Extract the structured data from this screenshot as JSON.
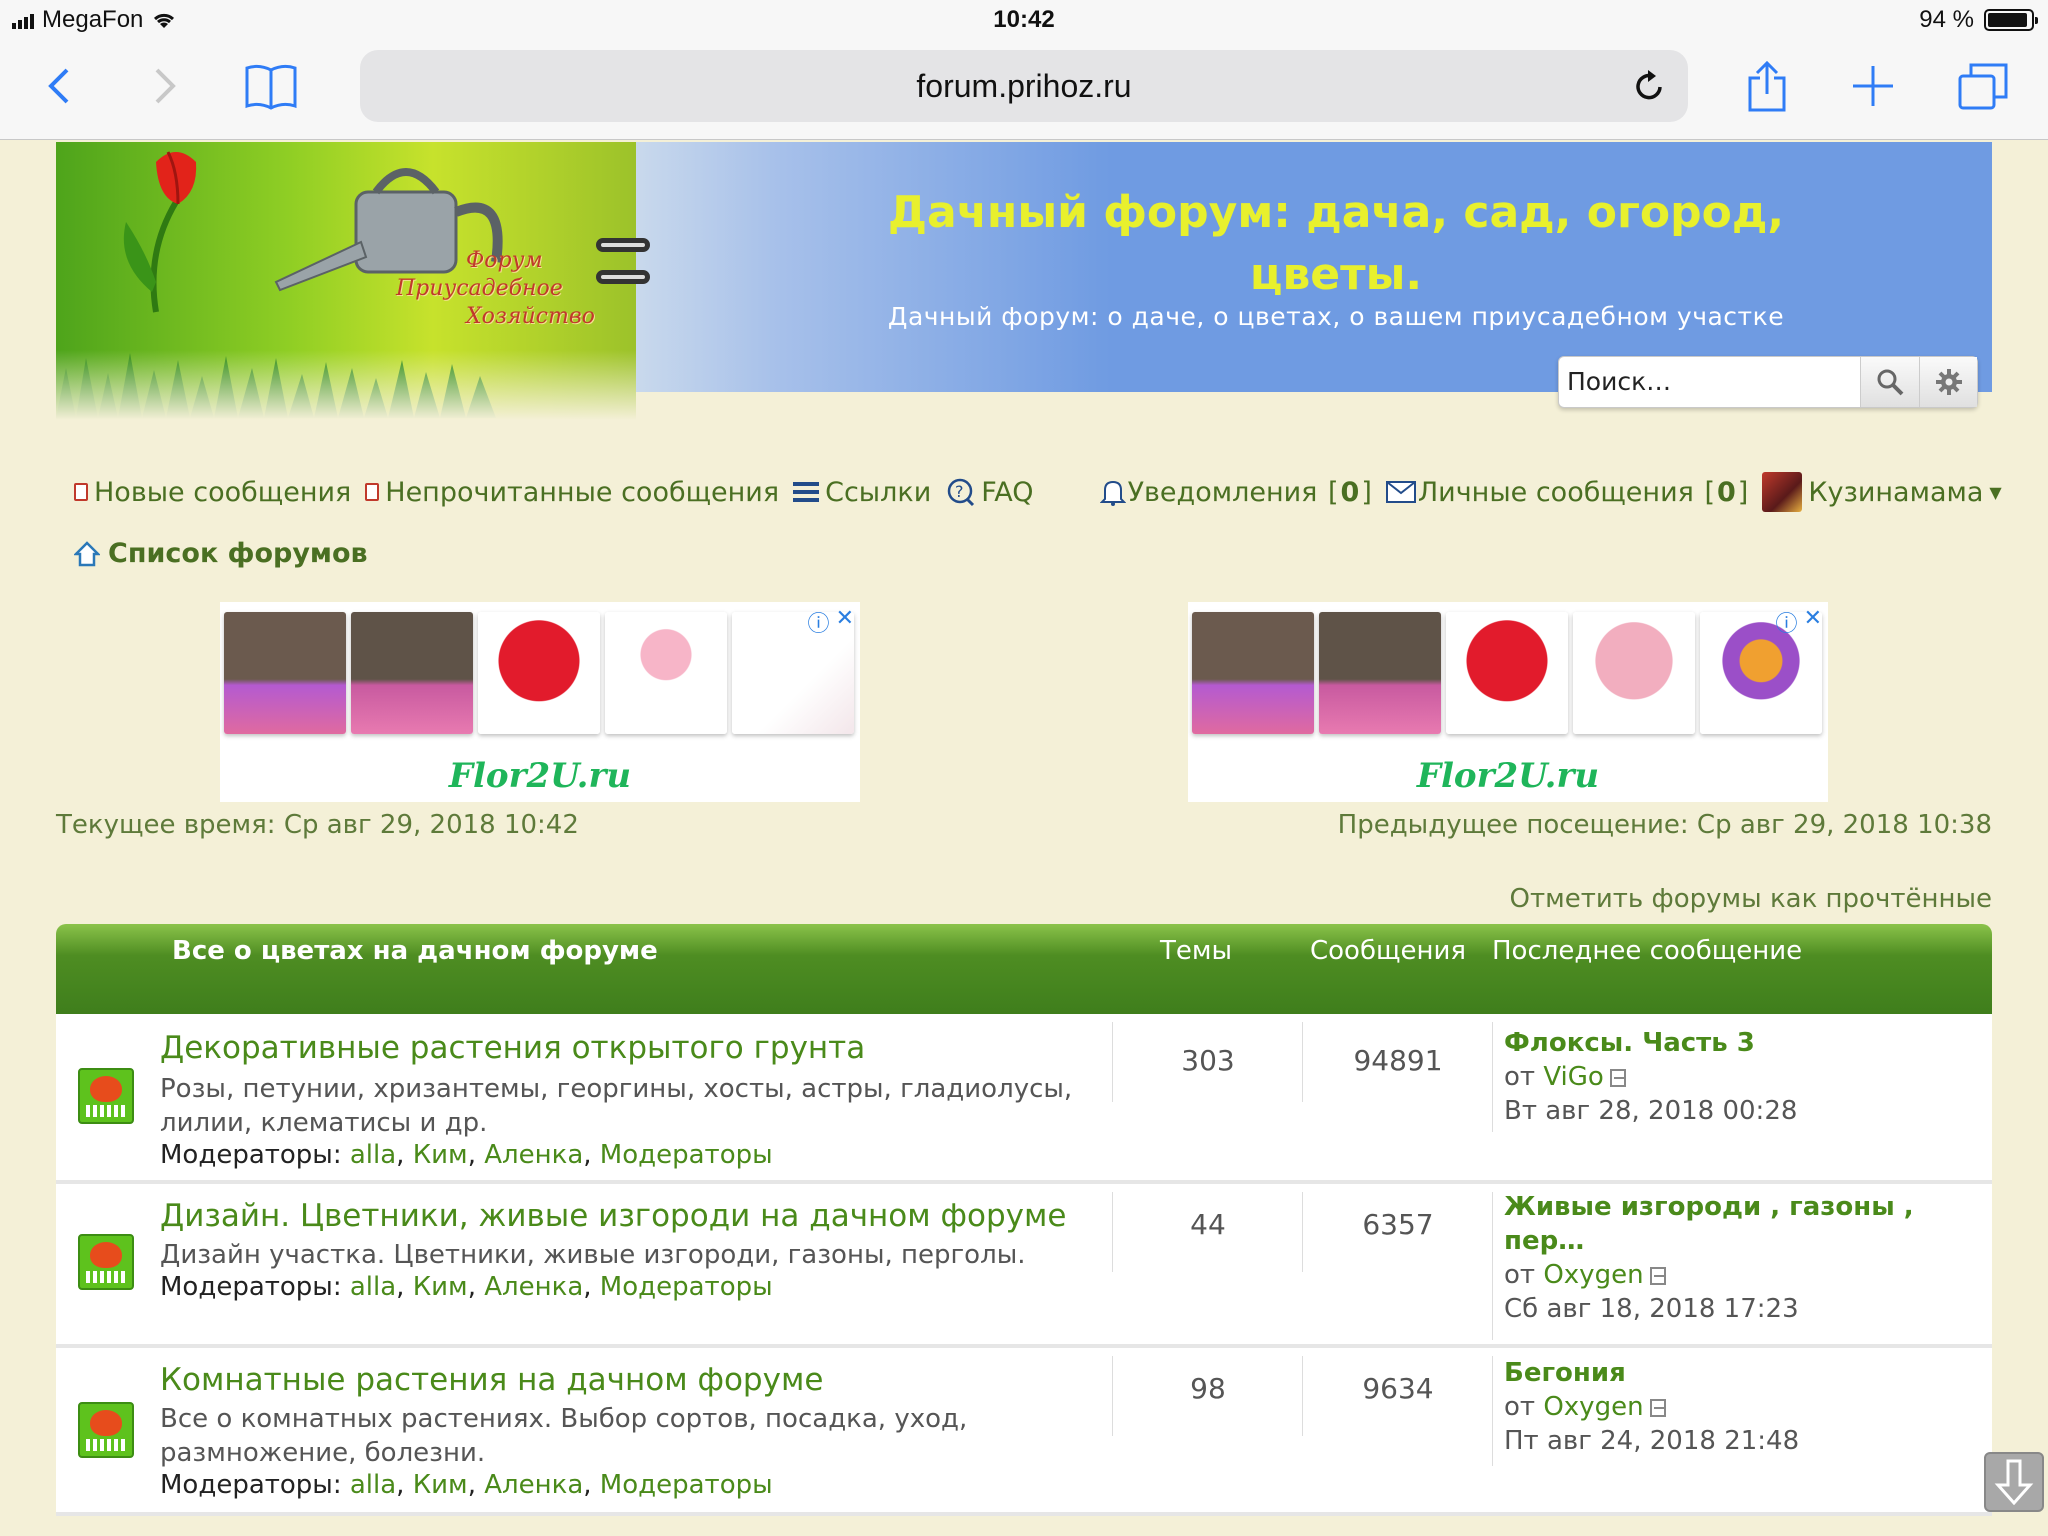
{
  "status": {
    "carrier": "MegaFon",
    "time": "10:42",
    "battery": "94 %"
  },
  "browser": {
    "url": "forum.prihoz.ru"
  },
  "header": {
    "title": "Дачный форум: дача, сад, огород, цветы.",
    "description": "Дачный форум: о даче, о цветах, о вашем приусадебном участке",
    "logo_lines": [
      "Форум",
      "Приусадебное",
      "Хозяйство"
    ],
    "search_placeholder": "Поиск…"
  },
  "nav": {
    "new_posts": "Новые сообщения",
    "unread_posts": "Непрочитанные сообщения",
    "links": "Ссылки",
    "faq": "FAQ",
    "notifications": "Уведомления",
    "notifications_count": "0",
    "private_messages": "Личные сообщения",
    "pm_count": "0",
    "username": "Кузинамама",
    "forum_list": "Список форумов"
  },
  "ads": {
    "brand": "Flor2U.ru"
  },
  "times": {
    "current": "Текущее время: Ср авг 29, 2018 10:42",
    "previous": "Предыдущее посещение: Ср авг 29, 2018 10:38",
    "mark_read": "Отметить форумы как прочтённые"
  },
  "table": {
    "category": "Все о цветах на дачном форуме",
    "col_topics": "Темы",
    "col_posts": "Сообщения",
    "col_last": "Последнее сообщение",
    "moderators_label": "Модераторы:",
    "moderators": [
      "alla",
      "Ким",
      "Аленка",
      "Модераторы"
    ],
    "by": "от",
    "forums": [
      {
        "title": "Декоративные растения открытого грунта",
        "desc": "Розы, петунии, хризантемы, георгины, хосты, астры, гладиолусы, лилии, клематисы и др.",
        "topics": "303",
        "posts": "94891",
        "last_title": "Флоксы. Часть 3",
        "last_author": "ViGo",
        "last_date": "Вт авг 28, 2018 00:28"
      },
      {
        "title": "Дизайн. Цветники, живые изгороди на дачном форуме",
        "desc": "Дизайн участка. Цветники, живые изгороди, газоны, перголы.",
        "topics": "44",
        "posts": "6357",
        "last_title": "Живые изгороди , газоны , пер…",
        "last_author": "Oxygen",
        "last_date": "Сб авг 18, 2018 17:23"
      },
      {
        "title": "Комнатные растения на дачном форуме",
        "desc": "Все о комнатных растениях. Выбор сортов, посадка, уход, размножение, болезни.",
        "topics": "98",
        "posts": "9634",
        "last_title": "Бегония",
        "last_author": "Oxygen",
        "last_date": "Пт авг 24, 2018 21:48"
      }
    ]
  }
}
